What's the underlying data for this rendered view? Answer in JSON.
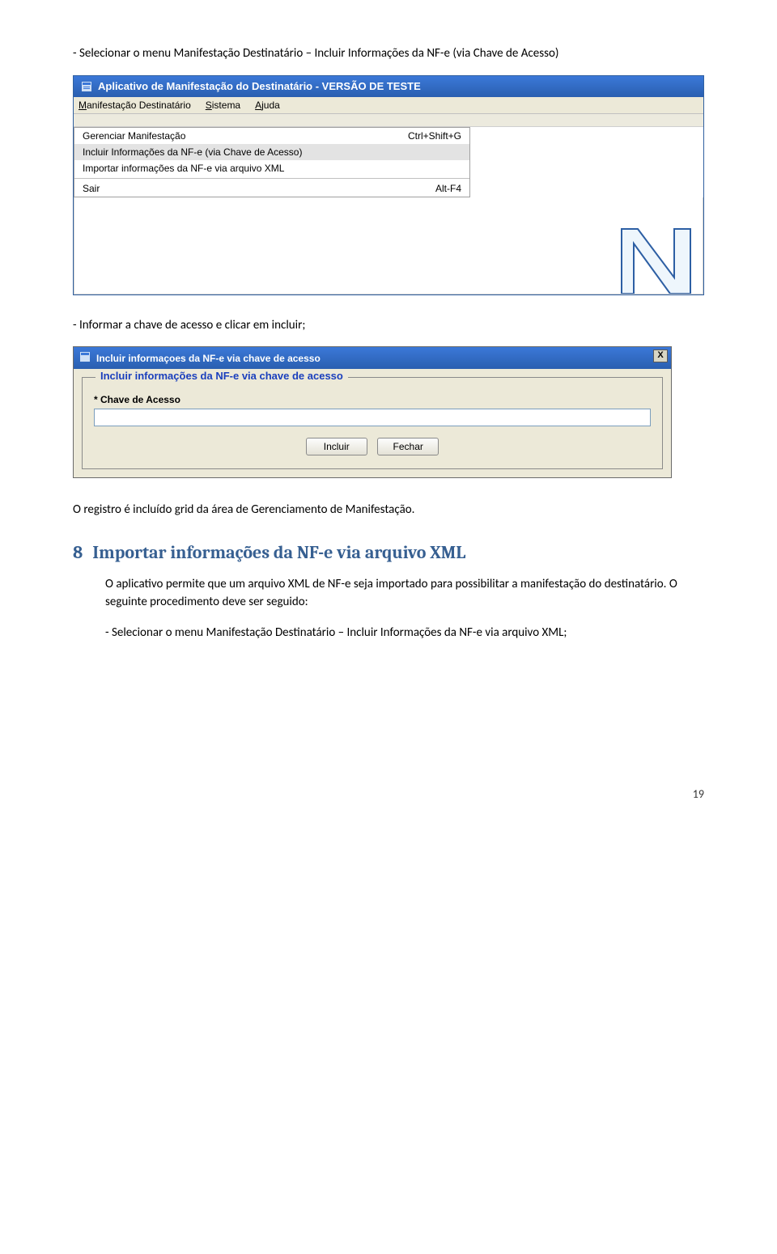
{
  "doc": {
    "intro_line": "- Selecionar o menu Manifestação Destinatário – Incluir Informações da NF-e (via Chave de Acesso)",
    "after_app": "- Informar a chave de acesso e clicar em incluir;",
    "after_dialog": "O registro é incluído grid da área de Gerenciamento de Manifestação.",
    "section_num": "8",
    "section_title": "Importar informações da NF-e via arquivo XML",
    "para1": "O aplicativo permite que um arquivo XML de NF-e seja importado para possibilitar a manifestação do destinatário. O seguinte procedimento deve ser seguido:",
    "para2": "- Selecionar o menu Manifestação Destinatário – Incluir Informações da NF-e via  arquivo XML;",
    "page_number": "19"
  },
  "app": {
    "title": "Aplicativo de Manifestação do Destinatário - VERSÃO DE TESTE",
    "menus": {
      "m1_pre": "M",
      "m1_rest": "anifestação Destinatário",
      "m2_pre": "S",
      "m2_rest": "istema",
      "m3_pre": "A",
      "m3_rest": "juda"
    },
    "dropdown": {
      "item1_label": "Gerenciar Manifestação",
      "item1_short": "Ctrl+Shift+G",
      "item2_label": "Incluir Informações da NF-e (via Chave de Acesso)",
      "item3_label": "Importar informações da NF-e via arquivo XML",
      "item4_label": "Sair",
      "item4_short": "Alt-F4"
    }
  },
  "dialog": {
    "title": "Incluir informaçoes da NF-e via chave de acesso",
    "legend": "Incluir informações da NF-e via chave de acesso",
    "field_label": "* Chave de Acesso",
    "input_value": "",
    "btn_incluir": "Incluir",
    "btn_fechar": "Fechar",
    "close_x": "X"
  }
}
